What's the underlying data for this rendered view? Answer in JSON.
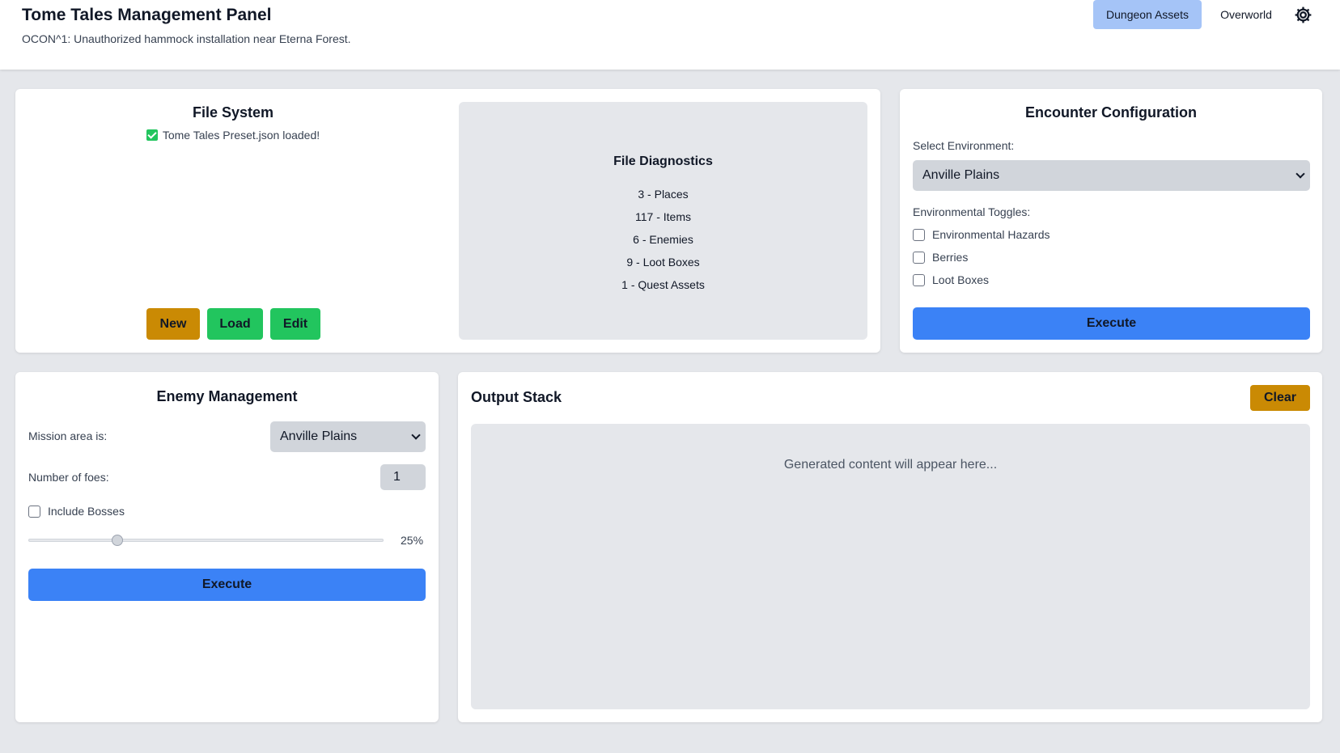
{
  "header": {
    "title": "Tome Tales Management Panel",
    "subtitle": "OCON^1: Unauthorized hammock installation near Eterna Forest.",
    "nav": {
      "active": "Dungeon Assets",
      "other": "Overworld"
    },
    "settings_icon": "gear-icon",
    "colors": {
      "active_tab": "#a5c4f7"
    }
  },
  "file_system": {
    "title": "File System",
    "status": "Tome Tales Preset.json loaded!",
    "status_icon": "checkbox-checked-icon",
    "buttons": {
      "new": "New",
      "load": "Load",
      "edit": "Edit"
    },
    "colors": {
      "new": "#ca8a04",
      "load": "#22c55e",
      "edit": "#22c55e"
    }
  },
  "diagnostics": {
    "title": "File Diagnostics",
    "items": [
      "3 - Places",
      "117 - Items",
      "6 - Enemies",
      "9 - Loot Boxes",
      "1 - Quest Assets"
    ]
  },
  "encounter": {
    "title": "Encounter Configuration",
    "env_label": "Select Environment:",
    "env_value": "Anville Plains",
    "toggles_label": "Environmental Toggles:",
    "toggles": [
      {
        "label": "Environmental Hazards",
        "checked": false
      },
      {
        "label": "Berries",
        "checked": false
      },
      {
        "label": "Loot Boxes",
        "checked": false
      }
    ],
    "execute": "Execute",
    "color": "#3b82f6"
  },
  "enemy": {
    "title": "Enemy Management",
    "area_label": "Mission area is:",
    "area_value": "Anville Plains",
    "foes_label": "Number of foes:",
    "foes_value": "1",
    "bosses_label": "Include Bosses",
    "bosses_checked": false,
    "slider_value": 0.25,
    "slider_text": "25%",
    "execute": "Execute"
  },
  "output": {
    "title": "Output Stack",
    "clear": "Clear",
    "placeholder": "Generated content will appear here..."
  }
}
